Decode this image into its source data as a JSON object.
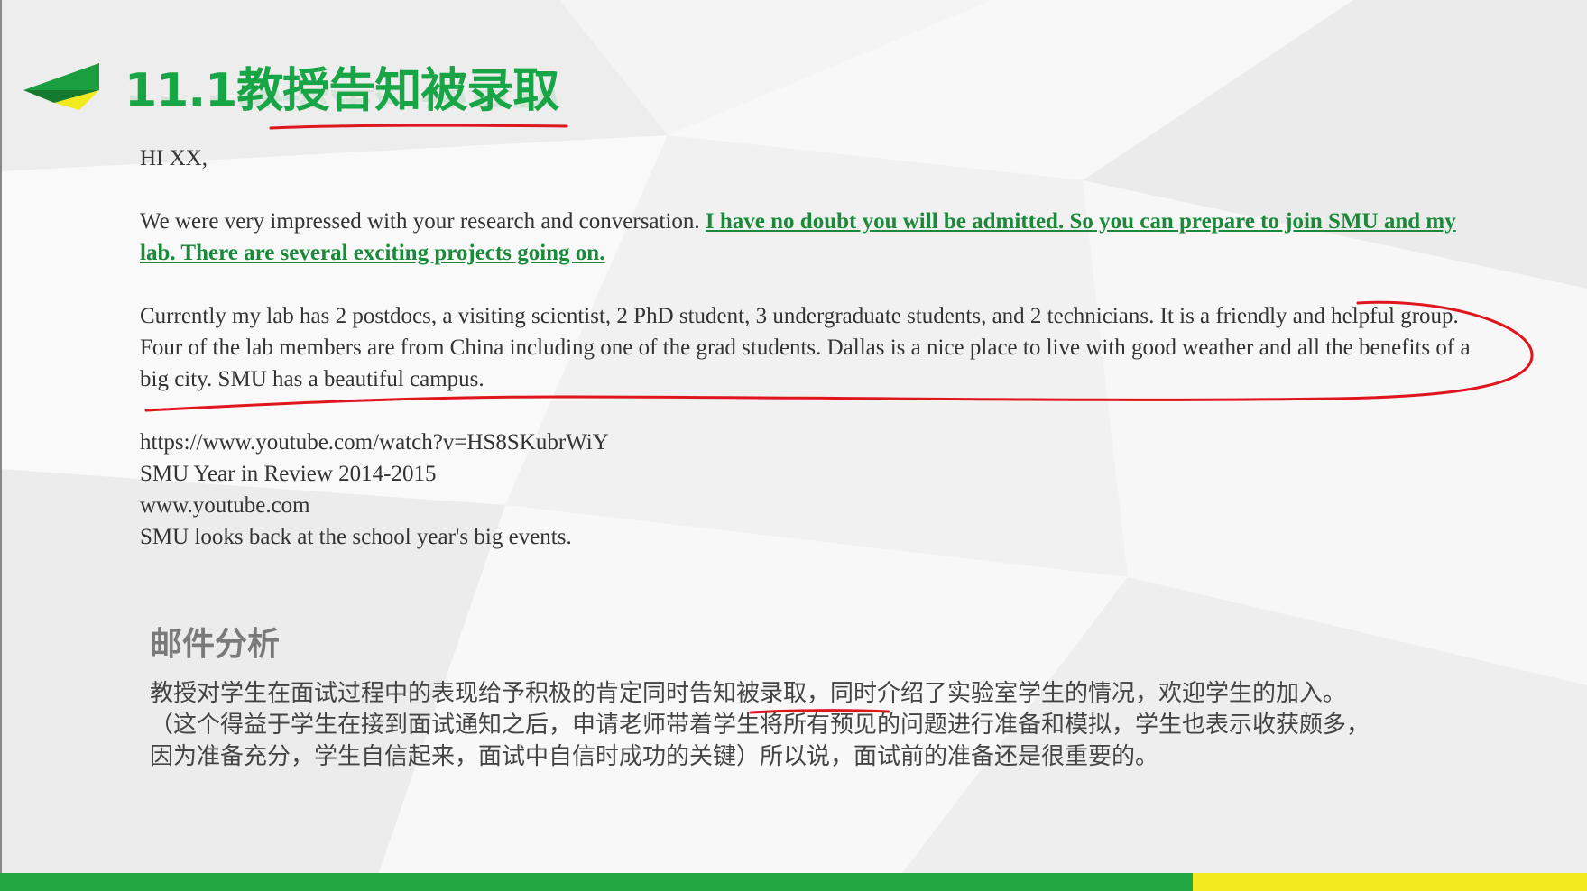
{
  "slide": {
    "title": "11.1教授告知被录取",
    "colors": {
      "accent_green": "#17a545",
      "annotation_red": "#e0161e",
      "bar_yellow": "#f2ea1f"
    }
  },
  "email": {
    "greeting": "HI XX,",
    "p1_normal": "We were very impressed with your research and conversation. ",
    "p1_highlight": "I have no doubt you will be admitted.  So you can prepare to join SMU and my lab. There are several exciting projects going on.",
    "p2": "Currently my lab has 2 postdocs, a visiting scientist, 2 PhD student, 3 undergraduate students, and 2 technicians. It is a friendly and helpful group.  Four of the lab members are from China including one of the grad students.  Dallas is a nice place to live with good weather and all the benefits of a big city. SMU has a beautiful campus.",
    "link_url": "https://www.youtube.com/watch?v=HS8SKubrWiY",
    "link_title": "SMU Year in Review 2014-2015",
    "link_domain": "www.youtube.com",
    "link_description": "SMU looks back at the school year's big events."
  },
  "analysis": {
    "heading": "邮件分析",
    "line1_a": "教授对学生在面试过程中的表现给予积极的肯定同时",
    "line1_underlined": "告知被录取",
    "line1_b": "，同时介绍了实验室学生的情况，欢迎学生的加入。",
    "line2": "（这个得益于学生在接到面试通知之后，申请老师带着学生将所有预见的问题进行准备和模拟，学生也表示收获颇多，",
    "line3": "因为准备充分，学生自信起来，面试中自信时成功的关键）所以说，面试前的准备还是很重要的。"
  }
}
